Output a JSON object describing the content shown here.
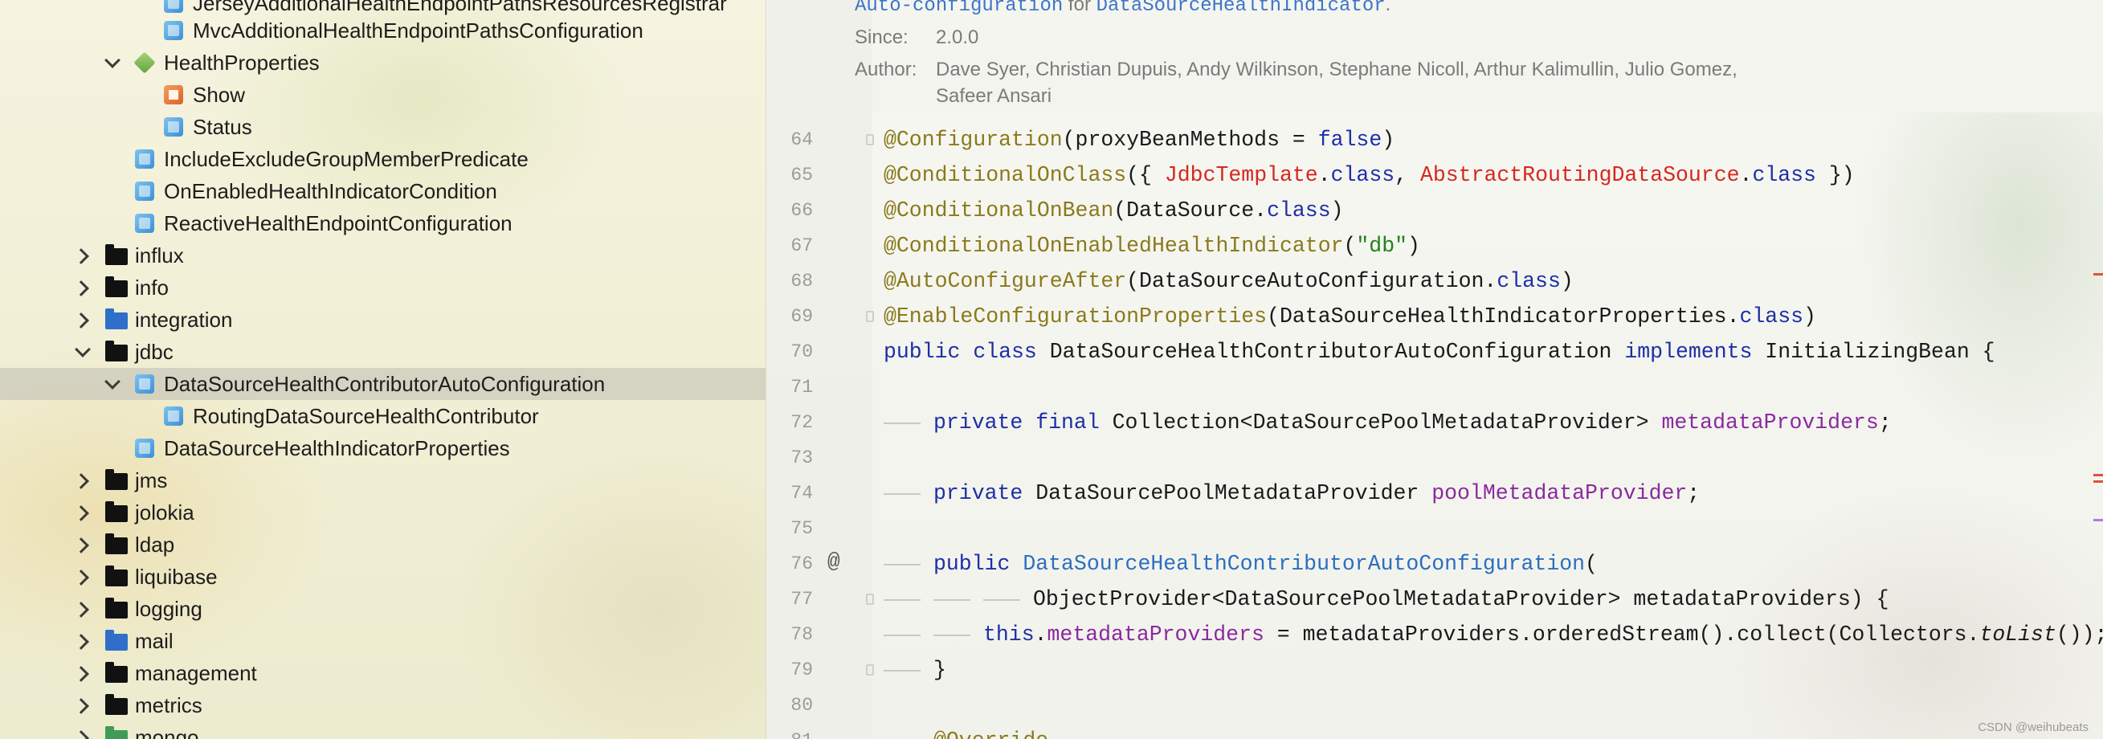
{
  "tree": {
    "items": [
      {
        "label": "JerseyAdditionalHealthEndpointPathsResourcesRegistrar",
        "icon": "class-icon"
      },
      {
        "label": "MvcAdditionalHealthEndpointPathsConfiguration",
        "icon": "class-icon"
      },
      {
        "label": "HealthProperties",
        "icon": "properties-icon"
      },
      {
        "label": "Show",
        "icon": "enum-icon"
      },
      {
        "label": "Status",
        "icon": "class-icon"
      },
      {
        "label": "IncludeExcludeGroupMemberPredicate",
        "icon": "class-icon"
      },
      {
        "label": "OnEnabledHealthIndicatorCondition",
        "icon": "class-icon"
      },
      {
        "label": "ReactiveHealthEndpointConfiguration",
        "icon": "class-icon"
      },
      {
        "label": "influx",
        "icon": "folder-icon"
      },
      {
        "label": "info",
        "icon": "folder-icon"
      },
      {
        "label": "integration",
        "icon": "folder-icon"
      },
      {
        "label": "jdbc",
        "icon": "folder-icon"
      },
      {
        "label": "DataSourceHealthContributorAutoConfiguration",
        "icon": "class-icon"
      },
      {
        "label": "RoutingDataSourceHealthContributor",
        "icon": "class-icon"
      },
      {
        "label": "DataSourceHealthIndicatorProperties",
        "icon": "class-icon"
      },
      {
        "label": "jms",
        "icon": "folder-icon"
      },
      {
        "label": "jolokia",
        "icon": "folder-icon"
      },
      {
        "label": "ldap",
        "icon": "folder-icon"
      },
      {
        "label": "liquibase",
        "icon": "folder-icon"
      },
      {
        "label": "logging",
        "icon": "folder-icon"
      },
      {
        "label": "mail",
        "icon": "folder-icon"
      },
      {
        "label": "management",
        "icon": "folder-icon"
      },
      {
        "label": "metrics",
        "icon": "folder-icon"
      },
      {
        "label": "mongo",
        "icon": "folder-icon"
      }
    ]
  },
  "doc": {
    "auto_config_link": "Auto-configuration",
    "auto_config_for": "for",
    "auto_config_target": "DataSourceHealthIndicator",
    "auto_config_period": ".",
    "since_label": "Since:",
    "since_value": "2.0.0",
    "author_label": "Author:",
    "author_line1": "Dave Syer, Christian Dupuis, Andy Wilkinson, Stephane Nicoll, Arthur Kalimullin, Julio Gomez,",
    "author_line2": "Safeer Ansari"
  },
  "gutter": {
    "line_numbers": [
      "64",
      "65",
      "66",
      "67",
      "68",
      "69",
      "70",
      "71",
      "72",
      "73",
      "74",
      "75",
      "76",
      "77",
      "78",
      "79",
      "80",
      "81"
    ],
    "override_marker": "@"
  },
  "code": {
    "l64": {
      "a": "@Configuration",
      "b": "(proxyBeanMethods = ",
      "c": "false",
      "d": ")"
    },
    "l65": {
      "a": "@ConditionalOnClass",
      "b": "({ ",
      "c": "JdbcTemplate",
      "d": ".",
      "e": "class",
      "f": ", ",
      "g": "AbstractRoutingDataSource",
      "h": ".",
      "i": "class",
      "j": " })"
    },
    "l66": {
      "a": "@ConditionalOnBean",
      "b": "(DataSource.",
      "c": "class",
      "d": ")"
    },
    "l67": {
      "a": "@ConditionalOnEnabledHealthIndicator",
      "b": "(",
      "c": "\"db\"",
      "d": ")"
    },
    "l68": {
      "a": "@AutoConfigureAfter",
      "b": "(DataSourceAutoConfiguration.",
      "c": "class",
      "d": ")"
    },
    "l69": {
      "a": "@EnableConfigurationProperties",
      "b": "(DataSourceHealthIndicatorProperties.",
      "c": "class",
      "d": ")"
    },
    "l70": {
      "a": "public class",
      "b": " DataSourceHealthContributorAutoConfiguration ",
      "c": "implements",
      "d": " InitializingBean {"
    },
    "l72": {
      "a": "private final",
      "b": " Collection<DataSourcePoolMetadataProvider> ",
      "c": "metadataProviders",
      "d": ";"
    },
    "l74": {
      "a": "private",
      "b": " DataSourcePoolMetadataProvider ",
      "c": "poolMetadataProvider",
      "d": ";"
    },
    "l76": {
      "a": "public",
      "b": " DataSourceHealthContributorAutoConfiguration",
      "c": "("
    },
    "l77": {
      "a": "ObjectProvider<DataSourcePoolMetadataProvider> metadataProviders) {"
    },
    "l78": {
      "a": "this",
      "b": ".",
      "c": "metadataProviders",
      "d": " = metadataProviders.orderedStream().collect(Collectors.",
      "e": "toList",
      "f": "());"
    },
    "l79": {
      "a": "}"
    },
    "l81": {
      "a": "@Override"
    }
  },
  "watermark": "CSDN @weihubeats",
  "colors": {
    "annotation": "#8a7a1c",
    "keyword": "#1d2fa8",
    "unresolved": "#d6281f",
    "field": "#8a2a9f",
    "string": "#23811b"
  }
}
